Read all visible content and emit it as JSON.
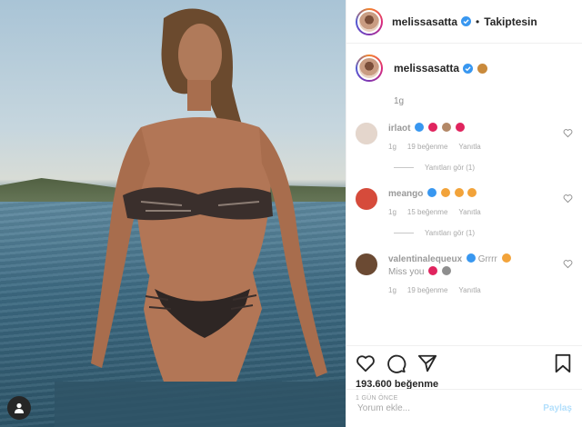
{
  "post": {
    "username": "melissasatta",
    "follow_status": "Takiptesin",
    "dot": "•",
    "caption_time": "1g",
    "likes": "193.600 beğenme",
    "date": "1 GÜN ÖNCE",
    "comment_placeholder": "Yorum ekle...",
    "post_label": "Paylaş"
  },
  "comments": [
    {
      "username": "irlaot",
      "text": "",
      "time": "1g",
      "likes": "19 beğenme",
      "reply": "Yanıtla",
      "view_replies": "Yanıtları gör (1)",
      "emoji_colors": [
        "#e0245e",
        "#b38867",
        "#e0245e"
      ]
    },
    {
      "username": "meango",
      "text": "",
      "time": "1g",
      "likes": "15 beğenme",
      "reply": "Yanıtla",
      "view_replies": "Yanıtları gör (1)",
      "emoji_colors": [
        "#f2a33a",
        "#f2a33a",
        "#f2a33a"
      ]
    },
    {
      "username": "valentinalequeux",
      "text": "Grrrr",
      "text2": "Miss you",
      "time": "1g",
      "likes": "19 beğenme",
      "reply": "Yanıtla",
      "emoji_colors": [
        "#f2a33a",
        "#e0245e",
        "#8e8e8e"
      ]
    }
  ],
  "colors": {
    "verified": "#3897f0",
    "heart_red": "#e0245e"
  },
  "icons": [
    "heart-icon",
    "comment-icon",
    "share-icon",
    "bookmark-icon",
    "user-tag-icon",
    "verified-badge-icon"
  ]
}
